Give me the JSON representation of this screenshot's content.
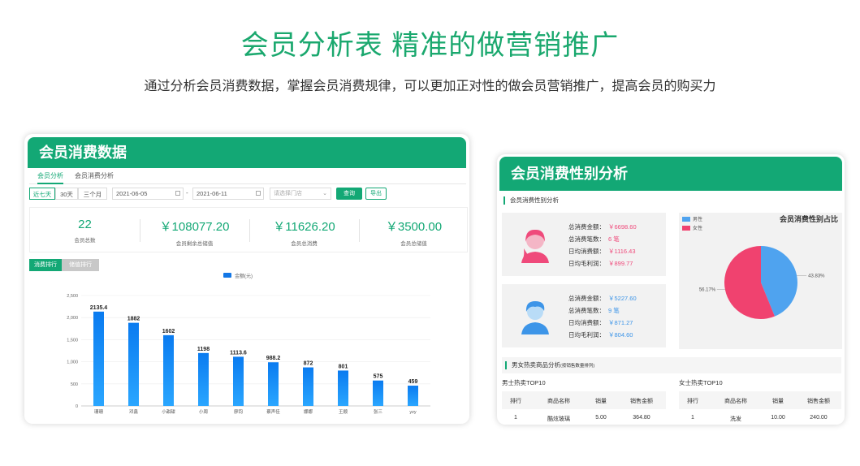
{
  "hero": {
    "title": "会员分析表 精准的做营销推广",
    "subtitle": "通过分析会员消费数据，掌握会员消费规律，可以更加正对性的做会员营销推广，提高会员的购买力"
  },
  "left_card": {
    "title": "会员消费数据",
    "tabs": [
      "会员分析",
      "会员消费分析"
    ],
    "range_buttons": [
      "近七天",
      "30天",
      "三个月"
    ],
    "date_from": "2021-06-05",
    "date_sep": "-",
    "date_to": "2021-06-11",
    "store_placeholder": "请选择门店",
    "query_label": "查询",
    "export_label": "导出",
    "stats": [
      {
        "value": "22",
        "label": "会员总数"
      },
      {
        "value": "￥108077.20",
        "label": "会员剩余总储值"
      },
      {
        "value": "￥11626.20",
        "label": "会员总消费"
      },
      {
        "value": "￥3500.00",
        "label": "会员总储值"
      }
    ],
    "chart_tabs": [
      "消费排行",
      "储值排行"
    ]
  },
  "chart_data": {
    "type": "bar",
    "legend": "金额(元)",
    "categories": [
      "珊珊",
      "邓鑫",
      "小甜甜",
      "小周",
      "廖钧",
      "蔡声佳",
      "娜娜",
      "王顺",
      "张三",
      "yzy"
    ],
    "values": [
      2135.4,
      1882,
      1602,
      1198,
      1113.6,
      988.2,
      872,
      801,
      575,
      459
    ],
    "value_labels": [
      "2135.4",
      "1882",
      "1602",
      "1198",
      "1113.6",
      "988.2",
      "872",
      "801",
      "575",
      "459"
    ],
    "ylim": [
      0,
      2500
    ],
    "yticks": [
      "0",
      "500",
      "1,000",
      "1,500",
      "2,000",
      "2,500"
    ],
    "ytick_values": [
      0,
      500,
      1000,
      1500,
      2000,
      2500
    ],
    "colors": {
      "bar_top": "#0a7bf0",
      "bar_bottom": "#2aa6ff",
      "legend": "#1377e6"
    }
  },
  "right_card": {
    "title": "会员消费性别分析",
    "section1": "会员消费性别分析",
    "female": {
      "rows": [
        {
          "k": "总消费金额：",
          "v": "￥6698.60"
        },
        {
          "k": "总消费笔数：",
          "v": "6 笔"
        },
        {
          "k": "日均消费额：",
          "v": "￥1116.43"
        },
        {
          "k": "日均毛利润：",
          "v": "￥899.77"
        }
      ]
    },
    "male": {
      "rows": [
        {
          "k": "总消费金额：",
          "v": "￥5227.60"
        },
        {
          "k": "总消费笔数：",
          "v": "9 笔"
        },
        {
          "k": "日均消费额：",
          "v": "￥871.27"
        },
        {
          "k": "日均毛利润：",
          "v": "￥804.60"
        }
      ]
    },
    "pie": {
      "title": "会员消费性别占比",
      "legend": [
        "男性",
        "女性"
      ],
      "male_pct": 43.83,
      "female_pct": 56.17,
      "male_label": "43.83%",
      "female_label": "56.17%",
      "colors": {
        "male": "#4fa3ef",
        "female": "#f0426f"
      }
    },
    "section2": "男女热卖商品分析",
    "section2_note": "(按销售数量排列)",
    "male_top": {
      "title": "男士热卖TOP10",
      "headers": [
        "排行",
        "商品名称",
        "销量",
        "销售金额"
      ],
      "row": [
        "1",
        "酷炫玻璃",
        "5.00",
        "364.80"
      ]
    },
    "female_top": {
      "title": "女士热卖TOP10",
      "headers": [
        "排行",
        "商品名称",
        "销量",
        "销售金额"
      ],
      "row": [
        "1",
        "洗发",
        "10.00",
        "240.00"
      ]
    }
  }
}
